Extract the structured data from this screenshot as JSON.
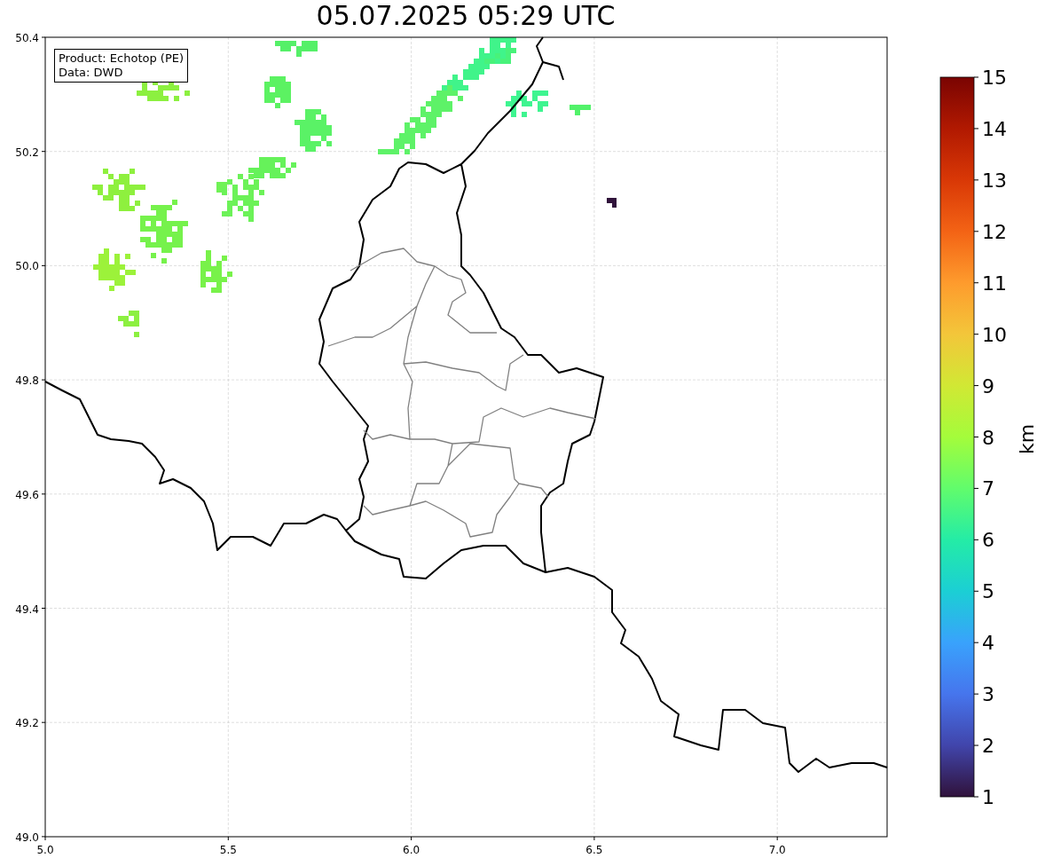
{
  "figure": {
    "title": "05.07.2025 05:29 UTC"
  },
  "map": {
    "info_box": [
      "Product: Echotop (PE)",
      "Data: DWD"
    ],
    "x_ticks": [
      "5.0",
      "5.5",
      "6.0",
      "6.5",
      "7.0"
    ],
    "y_ticks": [
      "50.4",
      "50.2",
      "50.0",
      "49.8",
      "49.6",
      "49.4",
      "49.2",
      "49.0"
    ]
  },
  "colorbar": {
    "label": "km",
    "ticks": [
      "15",
      "14",
      "13",
      "12",
      "11",
      "10",
      "9",
      "8",
      "7",
      "6",
      "5",
      "4",
      "3",
      "2",
      "1"
    ]
  }
}
